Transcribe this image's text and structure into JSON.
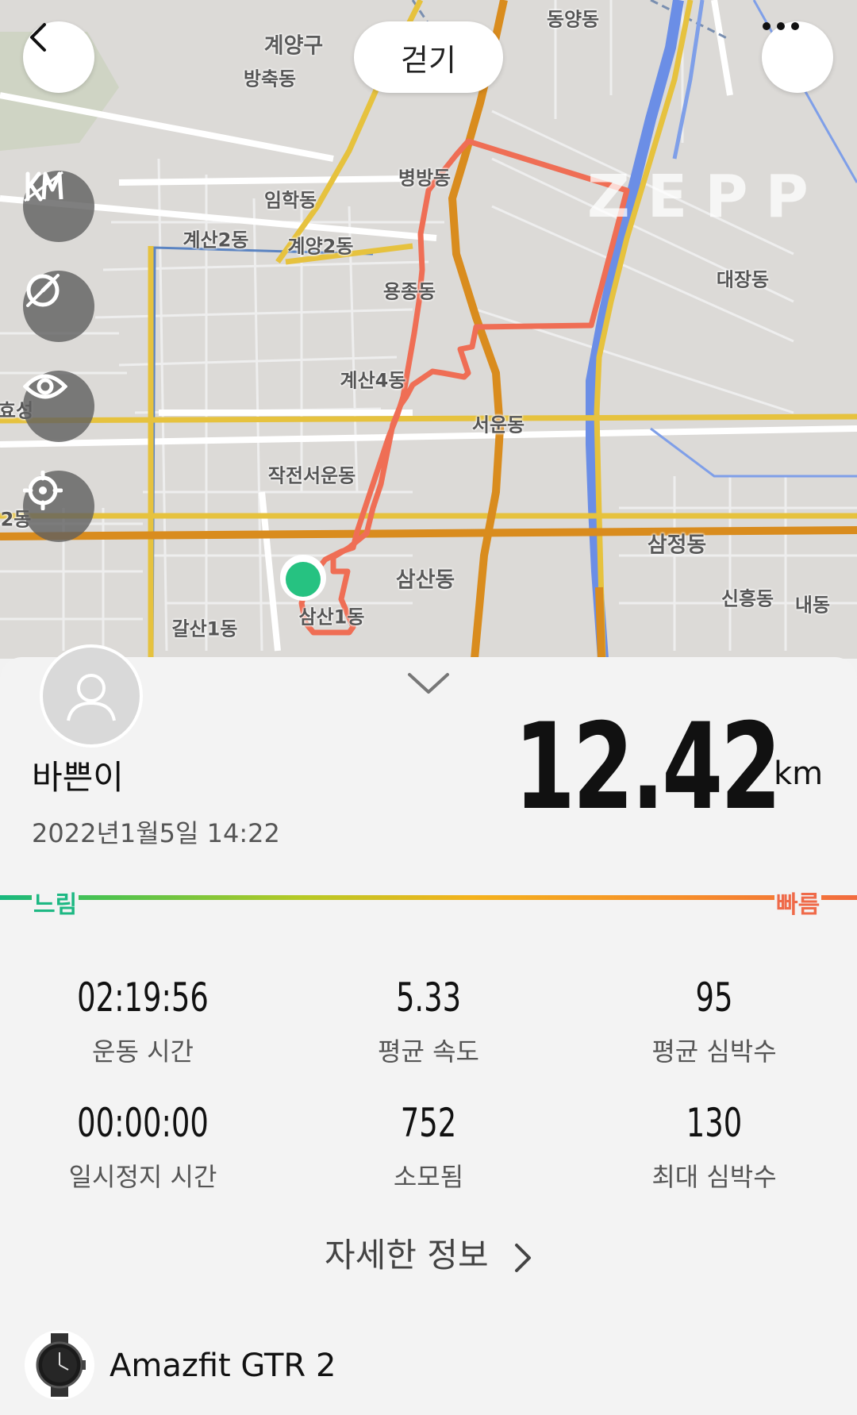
{
  "header": {
    "mode_label": "걷기",
    "watermark": "ZEPP"
  },
  "map": {
    "labels": [
      "계양구",
      "방축동",
      "동양동",
      "병방동",
      "임학동",
      "계산2동",
      "계양2동",
      "용종동",
      "대장동",
      "계산4동",
      "서운동",
      "효성",
      "작전서운동",
      "2동",
      "삼정동",
      "삼산동",
      "신흥동",
      "내동",
      "갈산1동",
      "삼산1동"
    ],
    "route_color": "#ef6e55",
    "start_marker_color": "#26c281"
  },
  "summary": {
    "username": "바쁜이",
    "datetime": "2022년1월5일 14:22",
    "distance": "12.42",
    "unit": "km"
  },
  "pace_legend": {
    "slow": "느림",
    "fast": "빠름"
  },
  "stats": [
    {
      "value": "02:19:56",
      "label": "운동 시간"
    },
    {
      "value": "5.33",
      "label": "평균 속도"
    },
    {
      "value": "95",
      "label": "평균 심박수"
    },
    {
      "value": "00:00:00",
      "label": "일시정지 시간"
    },
    {
      "value": "752",
      "label": "소모됨"
    },
    {
      "value": "130",
      "label": "최대 심박수"
    }
  ],
  "detail_link": "자세한 정보",
  "device": {
    "name": "Amazfit GTR 2"
  }
}
